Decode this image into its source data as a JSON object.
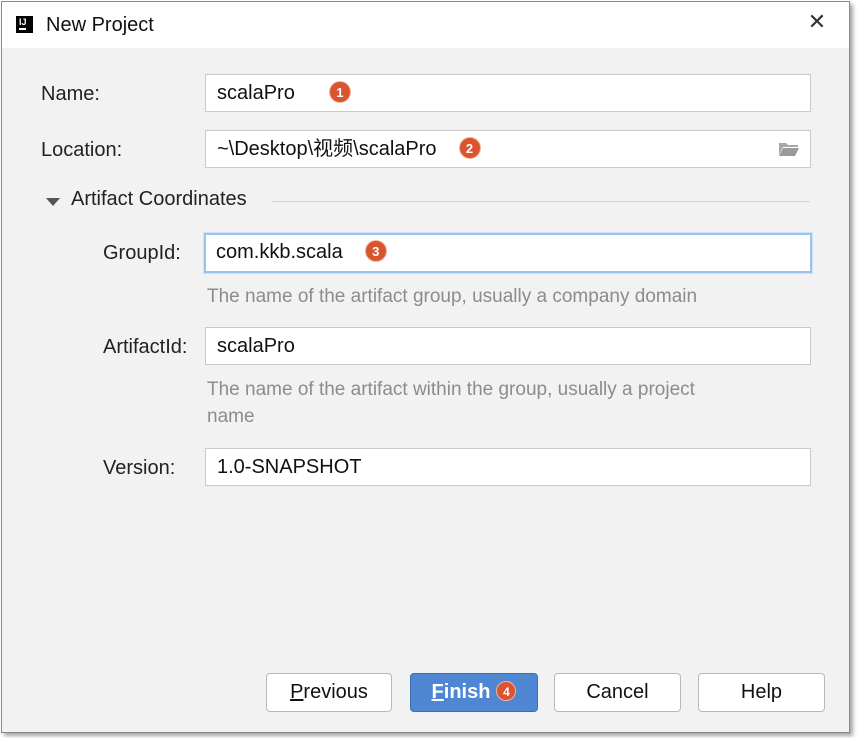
{
  "window": {
    "title": "New Project",
    "close_glyph": "✕"
  },
  "form": {
    "name": {
      "label": "Name:",
      "value": "scalaPro",
      "badge": "1"
    },
    "location": {
      "label": "Location:",
      "value": "~\\Desktop\\视频\\scalaPro",
      "badge": "2",
      "icon": "folder-icon"
    },
    "artifact_section": {
      "title": "Artifact Coordinates",
      "expanded": true,
      "group_id": {
        "label": "GroupId:",
        "value": "com.kkb.scala",
        "badge": "3",
        "hint": "The name of the artifact group, usually a company domain"
      },
      "artifact_id": {
        "label": "ArtifactId:",
        "value": "scalaPro",
        "hint_line1": "The name of the artifact within the group, usually a project",
        "hint_line2": "name"
      },
      "version": {
        "label": "Version:",
        "value": "1.0-SNAPSHOT"
      }
    }
  },
  "buttons": {
    "previous": {
      "mnemonic": "P",
      "rest": "revious"
    },
    "finish": {
      "mnemonic": "F",
      "rest": "inish",
      "badge": "4"
    },
    "cancel": "Cancel",
    "help": "Help"
  },
  "colors": {
    "accent": "#4f87d3",
    "badge": "#d9552f",
    "focus_ring": "#97c3ec",
    "hint_text": "#8c8c8c"
  }
}
